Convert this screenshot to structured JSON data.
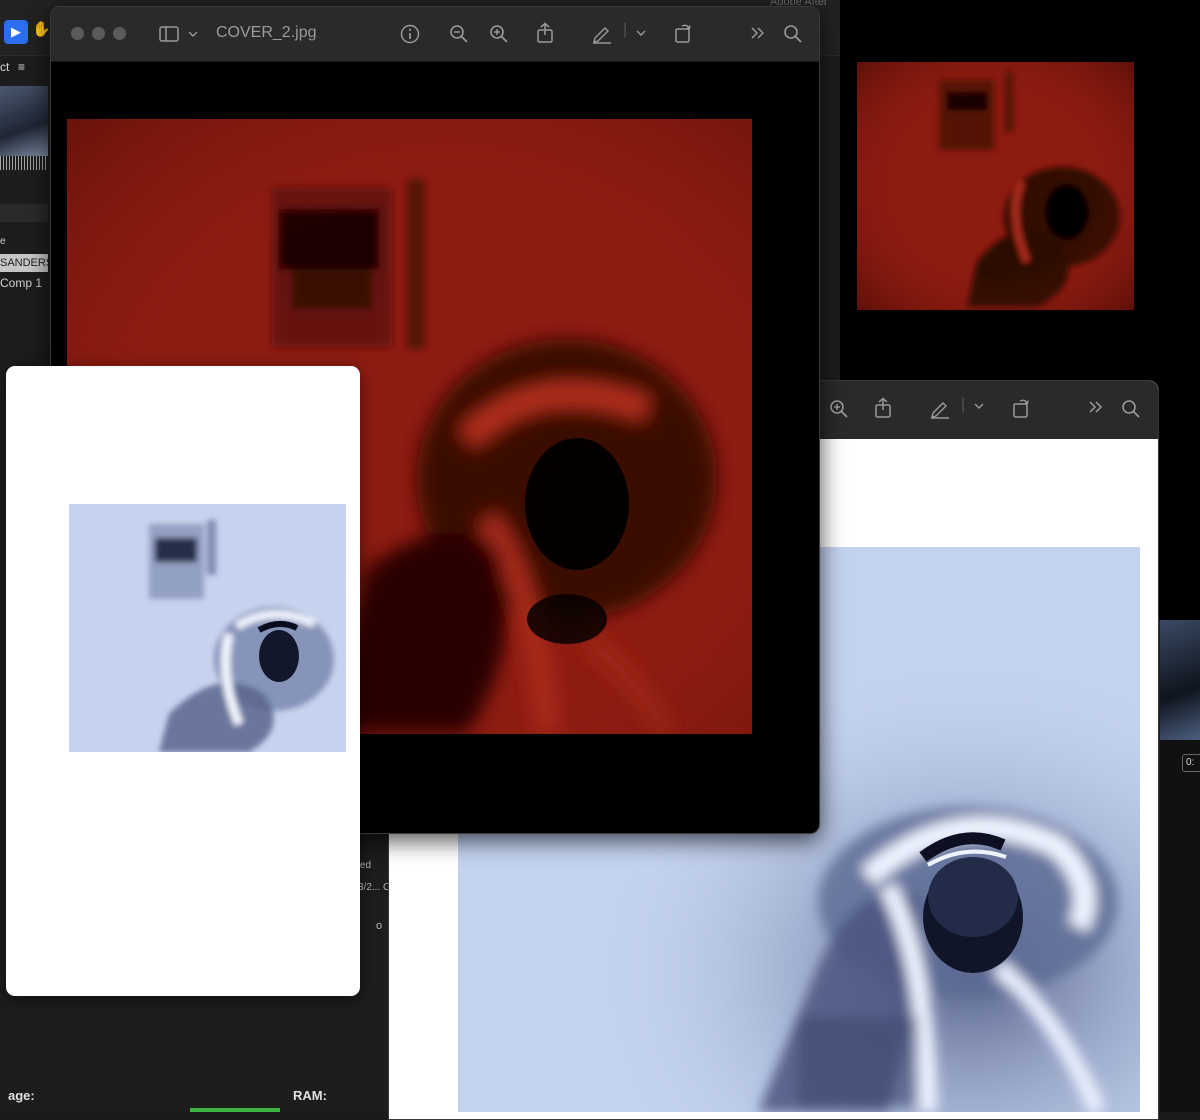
{
  "background_app": {
    "title_partial": "Adobe After",
    "select_tool_icon": "arrow-cursor-icon",
    "hand_tool_icon": "hand-icon",
    "project_tab": "ct",
    "project_menu_icon": "≡",
    "column_header": "e",
    "items": [
      "SANDERS",
      "Comp 1"
    ],
    "right_timecode": "0:",
    "left_fragments": {
      "rect": "ed",
      "value": "3/2... C",
      "o": "o"
    },
    "status_left": "age:",
    "status_ram": "RAM:"
  },
  "preview_main": {
    "window_title": "COVER_2.jpg",
    "toolbar_icons": [
      "sidebar-icon",
      "chevron-down-icon",
      "info-icon",
      "zoom-out-icon",
      "zoom-in-icon",
      "share-icon",
      "markup-pen-icon",
      "chevron-down-icon",
      "rotate-icon",
      "more-chevrons-icon",
      "search-icon"
    ],
    "image_tint": "#8a1a10"
  },
  "preview_red_small": {
    "image_tint": "#8a1a10"
  },
  "preview_pdf": {
    "toolbar_icons": [
      "zoom-in-icon",
      "share-icon",
      "markup-pen-icon",
      "chevron-down-icon",
      "rotate-icon",
      "more-chevrons-icon",
      "search-icon"
    ],
    "image_tint": "#c2d1ee"
  },
  "floating_card": {
    "image_tint": "#c8d4ee"
  },
  "colors": {
    "red_tint": "#8a1a10",
    "blue_tint": "#c2d1ee",
    "accent_blue": "#2b6ff0"
  }
}
